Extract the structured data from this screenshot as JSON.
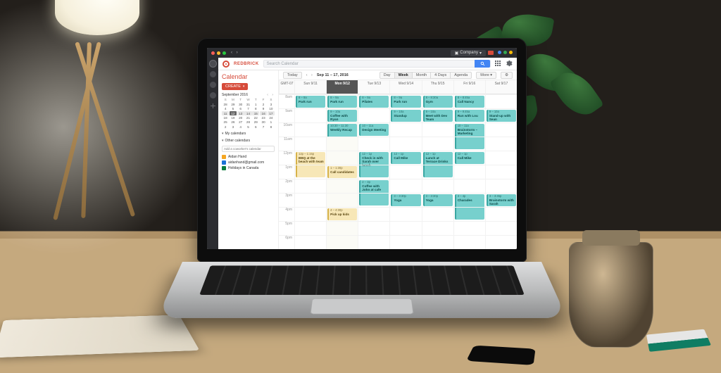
{
  "titlebar": {
    "company_label": "Company"
  },
  "brand": {
    "name": "REDBRICK",
    "search_placeholder": "Search Calendar"
  },
  "sidebar": {
    "title": "Calendar",
    "create_label": "CREATE",
    "mini": {
      "month_label": "September 2016",
      "dow": [
        "S",
        "M",
        "T",
        "W",
        "T",
        "F",
        "S"
      ],
      "days": [
        "28",
        "29",
        "30",
        "31",
        "1",
        "2",
        "3",
        "4",
        "5",
        "6",
        "7",
        "8",
        "9",
        "10",
        "11",
        "12",
        "13",
        "14",
        "15",
        "16",
        "17",
        "18",
        "19",
        "20",
        "21",
        "22",
        "23",
        "24",
        "25",
        "26",
        "27",
        "28",
        "29",
        "30",
        "1",
        "2",
        "3",
        "4",
        "5",
        "6",
        "7",
        "8"
      ],
      "highlight_row_start_index": 14,
      "today_index": 15
    },
    "sections": {
      "mine": "My calendars",
      "other": "Other calendars"
    },
    "other_placeholder": "Add a coworker's calendar",
    "calendars": [
      {
        "color": "sq-orange",
        "label": "Aidan Hand"
      },
      {
        "color": "sq-blue",
        "label": "aidanhand@gmail.com"
      },
      {
        "color": "sq-green",
        "label": "Holidays in Canada"
      }
    ]
  },
  "toolbar": {
    "today": "Today",
    "range": "Sep 11 – 17, 2016",
    "views": [
      "Day",
      "Week",
      "Month",
      "4 Days",
      "Agenda"
    ],
    "active_view_index": 1,
    "more": "More ▾",
    "gear": "⚙"
  },
  "columns": [
    "Sun 9/11",
    "Mon 9/12",
    "Tue 9/13",
    "Wed 9/14",
    "Thu 9/15",
    "Fri 9/16",
    "Sat 9/17"
  ],
  "today_col_index": 1,
  "hours": [
    "GMT-07",
    "8am",
    "9am",
    "10am",
    "11am",
    "12pm",
    "1pm",
    "2pm",
    "3pm",
    "4pm",
    "5pm",
    "6pm"
  ],
  "events": [
    {
      "col": 0,
      "row": 1,
      "span": 1,
      "time": "8 – 9a",
      "title": "Park run"
    },
    {
      "col": 1,
      "row": 1,
      "span": 1,
      "time": "8 – 9a",
      "title": "Park run"
    },
    {
      "col": 1,
      "row": 2,
      "span": 1,
      "time": "9 – 10a",
      "title": "Coffee with Ryan"
    },
    {
      "col": 1,
      "row": 3,
      "span": 2,
      "time": "10:30 – 11:30",
      "title": "Weekly Recap"
    },
    {
      "col": 1,
      "row": 6,
      "span": 1,
      "time": "1 – 1:30p",
      "title": "Call candidates",
      "style": "amber"
    },
    {
      "col": 1,
      "row": 9,
      "span": 1,
      "time": "4 – 4:30p",
      "title": "Pick up kids",
      "style": "amber"
    },
    {
      "col": 2,
      "row": 1,
      "span": 1,
      "time": "8 – 9a",
      "title": "Pilates"
    },
    {
      "col": 2,
      "row": 3,
      "span": 1,
      "time": "10 – 11a",
      "title": "Design Meeting"
    },
    {
      "col": 2,
      "row": 5,
      "span": 2,
      "time": "12 – 1p",
      "title": "Check in with Sarah over lunch"
    },
    {
      "col": 2,
      "row": 7,
      "span": 2,
      "time": "2 – 3p",
      "title": "Coffee with John at cafe"
    },
    {
      "col": 3,
      "row": 1,
      "span": 1,
      "time": "8 – 9a",
      "title": "Park run"
    },
    {
      "col": 3,
      "row": 2,
      "span": 1,
      "time": "9 – 10a",
      "title": "Standup"
    },
    {
      "col": 3,
      "row": 5,
      "span": 1,
      "time": "12 – 1p",
      "title": "Call Mike"
    },
    {
      "col": 3,
      "row": 8,
      "span": 1,
      "time": "3 – 3:30p",
      "title": "Yoga"
    },
    {
      "col": 4,
      "row": 1,
      "span": 1,
      "time": "8 – 8:30a",
      "title": "Gym"
    },
    {
      "col": 4,
      "row": 2,
      "span": 1,
      "time": "9 – 10a",
      "title": "Meet with Dev Team"
    },
    {
      "col": 4,
      "row": 5,
      "span": 2,
      "time": "12 – 1p",
      "title": "Lunch at Terrace Drinks"
    },
    {
      "col": 4,
      "row": 8,
      "span": 1,
      "time": "3 – 3:30p",
      "title": "Yoga"
    },
    {
      "col": 5,
      "row": 1,
      "span": 1,
      "time": "8 – 8:45a",
      "title": "Call Nancy"
    },
    {
      "col": 5,
      "row": 2,
      "span": 1,
      "time": "9 – 9:45a",
      "title": "Run with Lou"
    },
    {
      "col": 5,
      "row": 3,
      "span": 2,
      "time": "10 – 11a",
      "title": "Brainstorm – Marketing"
    },
    {
      "col": 5,
      "row": 5,
      "span": 1,
      "time": "12 – 1p",
      "title": "Call Mike"
    },
    {
      "col": 5,
      "row": 8,
      "span": 2,
      "time": "3 – 4p",
      "title": "Charades"
    },
    {
      "col": 6,
      "row": 2,
      "span": 1,
      "time": "9 – 10a",
      "title": "Stand-up with Sean"
    },
    {
      "col": 6,
      "row": 8,
      "span": 1,
      "time": "3 – 3:45p",
      "title": "Brainstorm with Sarah"
    },
    {
      "col": 0,
      "row": 5,
      "span": 2,
      "time": "12p – 1:15p",
      "title": "BBQ at the beach with team",
      "style": "amber"
    }
  ]
}
